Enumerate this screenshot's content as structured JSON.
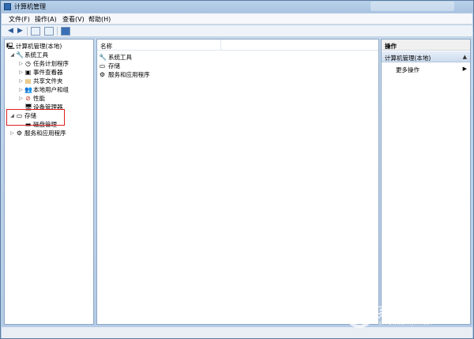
{
  "window": {
    "title": "计算机管理"
  },
  "menubar": {
    "items": [
      "文件(F)",
      "操作(A)",
      "查看(V)",
      "帮助(H)"
    ]
  },
  "toolbar": {
    "icons": [
      "back-arrow-icon",
      "forward-arrow-icon",
      "show-tree-icon",
      "export-icon",
      "help-icon"
    ]
  },
  "tree": {
    "root": "计算机管理(本地)",
    "items": [
      {
        "label": "系统工具",
        "level": 1,
        "expander": "◢"
      },
      {
        "label": "任务计划程序",
        "level": 2,
        "expander": "▷"
      },
      {
        "label": "事件查看器",
        "level": 2,
        "expander": "▷"
      },
      {
        "label": "共享文件夹",
        "level": 2,
        "expander": "▷"
      },
      {
        "label": "本地用户和组",
        "level": 2,
        "expander": "▷"
      },
      {
        "label": "性能",
        "level": 2,
        "expander": "▷"
      },
      {
        "label": "设备管理器",
        "level": 2,
        "expander": ""
      },
      {
        "label": "存储",
        "level": 1,
        "expander": "◢"
      },
      {
        "label": "磁盘管理",
        "level": 2,
        "expander": ""
      },
      {
        "label": "服务和应用程序",
        "level": 1,
        "expander": "▷"
      }
    ]
  },
  "list": {
    "column": "名称",
    "rows": [
      "系统工具",
      "存储",
      "服务和应用程序"
    ]
  },
  "actions": {
    "header": "操作",
    "section": "计算机管理(本地)",
    "section_caret": "▲",
    "link": "更多操作",
    "link_arrow": "▶"
  },
  "watermark": {
    "text": "系统之家",
    "sub": "XITONGZHIJIA.NET"
  },
  "colors": {
    "highlight": "#e0201e",
    "frame": "#b9d1ea"
  }
}
